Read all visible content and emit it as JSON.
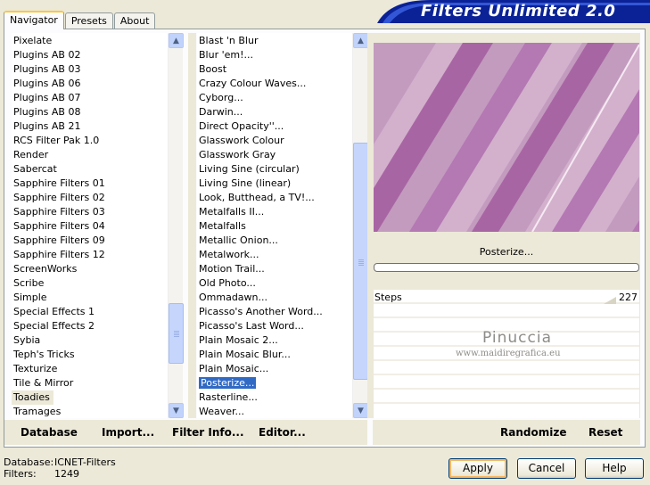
{
  "app": {
    "title": "Filters Unlimited 2.0",
    "banner_color": "#0a2296"
  },
  "tabs": [
    {
      "label": "Navigator",
      "active": true
    },
    {
      "label": "Presets",
      "active": false
    },
    {
      "label": "About",
      "active": false
    }
  ],
  "categories": {
    "items": [
      "Pixelate",
      "Plugins AB 02",
      "Plugins AB 03",
      "Plugins AB 06",
      "Plugins AB 07",
      "Plugins AB 08",
      "Plugins AB 21",
      "RCS Filter Pak 1.0",
      "Render",
      "Sabercat",
      "Sapphire Filters 01",
      "Sapphire Filters 02",
      "Sapphire Filters 03",
      "Sapphire Filters 04",
      "Sapphire Filters 09",
      "Sapphire Filters 12",
      "ScreenWorks",
      "Scribe",
      "Simple",
      "Special Effects 1",
      "Special Effects 2",
      "Sybia",
      "Teph's Tricks",
      "Texturize",
      "Tile & Mirror",
      "Toadies",
      "Tramages"
    ],
    "selected": "Toadies"
  },
  "filters": {
    "items": [
      "Blast 'n Blur",
      "Blur 'em!...",
      "Boost",
      "Crazy Colour Waves...",
      "Cyborg...",
      "Darwin...",
      "Direct Opacity''...",
      "Glasswork Colour",
      "Glasswork Gray",
      "Living Sine (circular)",
      "Living Sine (linear)",
      "Look, Butthead, a TV!...",
      "Metalfalls II...",
      "Metalfalls",
      "Metallic Onion...",
      "Metalwork...",
      "Motion Trail...",
      "Old Photo...",
      "Ommadawn...",
      "Picasso's Another Word...",
      "Picasso's Last Word...",
      "Plain Mosaic 2...",
      "Plain Mosaic Blur...",
      "Plain Mosaic...",
      "Posterize...",
      "Rasterline...",
      "Weaver..."
    ],
    "selected": "Posterize..."
  },
  "left_buttons": {
    "database": "Database",
    "import": "Import...",
    "filter_info": "Filter Info...",
    "editor": "Editor..."
  },
  "right_buttons": {
    "randomize": "Randomize",
    "reset": "Reset"
  },
  "preview": {
    "filter_name": "Posterize...",
    "colors": [
      "#c39bbf",
      "#a865a3",
      "#d3b1cd",
      "#b478b3"
    ]
  },
  "params": {
    "steps_label": "Steps",
    "steps_value": "227"
  },
  "watermark": {
    "name": "Pinuccia",
    "url": "www.maidiregrafica.eu"
  },
  "status": {
    "database_label": "Database:",
    "database_value": "ICNET-Filters",
    "filters_label": "Filters:",
    "filters_value": "1249"
  },
  "dialog_buttons": {
    "apply": "Apply",
    "cancel": "Cancel",
    "help": "Help"
  }
}
